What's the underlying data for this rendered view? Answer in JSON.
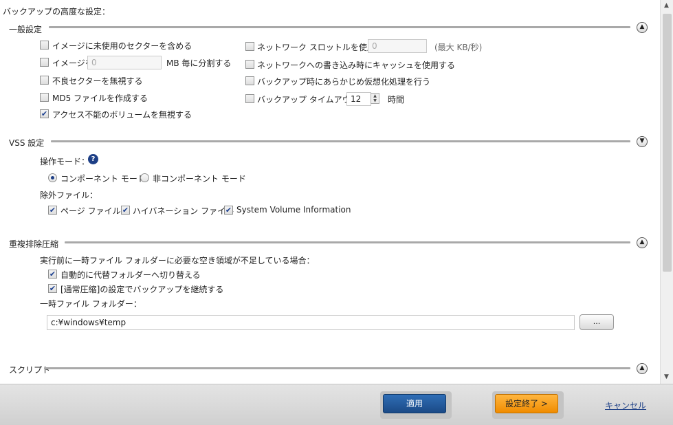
{
  "page_title": "バックアップの高度な設定：",
  "general": {
    "heading": "一般設定",
    "include_unused_sectors": {
      "label": "イメージに未使用のセクターを含める",
      "checked": false
    },
    "split_image": {
      "label_before": "イメージを",
      "value": "0",
      "label_after": "MB 毎に分割する",
      "checked": false
    },
    "ignore_bad_sectors": {
      "label": "不良セクターを無視する",
      "checked": false
    },
    "create_md5": {
      "label": "MD5 ファイルを作成する",
      "checked": false
    },
    "ignore_inaccessible": {
      "label": "アクセス不能のボリュームを無視する",
      "checked": true
    },
    "network_throttle": {
      "label": "ネットワーク スロットルを使用する",
      "value": "0",
      "unit": "(最大 KB/秒)",
      "checked": false
    },
    "write_cache": {
      "label": "ネットワークへの書き込み時にキャッシュを使用する",
      "checked": false
    },
    "pre_virtualize": {
      "label": "バックアップ時にあらかじめ仮想化処理を行う",
      "checked": false
    },
    "backup_timeout": {
      "label": "バックアップ タイムアウト：",
      "value": "12",
      "unit": "時間",
      "checked": false
    }
  },
  "vss": {
    "heading": "VSS 設定",
    "mode_label": "操作モード：",
    "help_glyph": "?",
    "component_mode": {
      "label": "コンポーネント モード",
      "selected": true
    },
    "non_component_mode": {
      "label": "非コンポーネント モード",
      "selected": false
    },
    "exclude_label": "除外ファイル：",
    "page_file": {
      "label": "ページ ファイル",
      "checked": true
    },
    "hibernation_file": {
      "label": "ハイバネーション ファイル",
      "checked": true
    },
    "system_volume_info": {
      "label": "System Volume Information",
      "checked": true
    }
  },
  "dedup": {
    "heading": "重複排除圧縮",
    "insufficient_space_label": "実行前に一時ファイル フォルダーに必要な空き領域が不足している場合：",
    "auto_switch": {
      "label": "自動的に代替フォルダーへ切り替える",
      "checked": true
    },
    "continue_normal": {
      "label": "[通常圧縮]の設定でバックアップを継続する",
      "checked": true
    },
    "temp_folder_label": "一時ファイル フォルダー：",
    "temp_folder_value": "c:¥windows¥temp",
    "browse_label": "..."
  },
  "script": {
    "heading": "スクリプト"
  },
  "footer": {
    "apply_label": "適用",
    "finish_label": "設定終了 >",
    "cancel_label": "キャンセル"
  },
  "colors": {
    "apply": "#1b4a86",
    "finish": "#f39a10",
    "link": "#1d3f86"
  },
  "icons": {
    "expanded": "chevron-up-icon",
    "collapsed": "chevron-down-icon",
    "help": "help-icon"
  }
}
